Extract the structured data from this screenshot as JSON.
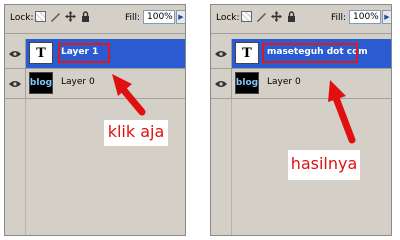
{
  "panels": [
    {
      "lock_label": "Lock:",
      "fill_label": "Fill:",
      "fill_value": "100%",
      "layers": [
        {
          "name": "Layer 1",
          "thumb": "T",
          "selected": true
        },
        {
          "name": "Layer 0",
          "thumb": "blog",
          "selected": false
        }
      ],
      "callout": "klik aja"
    },
    {
      "lock_label": "Lock:",
      "fill_label": "Fill:",
      "fill_value": "100%",
      "layers": [
        {
          "name": "maseteguh dot com",
          "thumb": "T",
          "selected": true
        },
        {
          "name": "Layer 0",
          "thumb": "blog",
          "selected": false
        }
      ],
      "callout": "hasilnya"
    }
  ],
  "icons": [
    "transparency-lock-icon",
    "brush-icon",
    "move-icon",
    "lock-icon",
    "eye-icon",
    "red-arrow-icon"
  ],
  "colors": {
    "selected_row": "#2a5bd1",
    "highlight_red": "#e01818",
    "panel_bg": "#d4d0c8"
  }
}
